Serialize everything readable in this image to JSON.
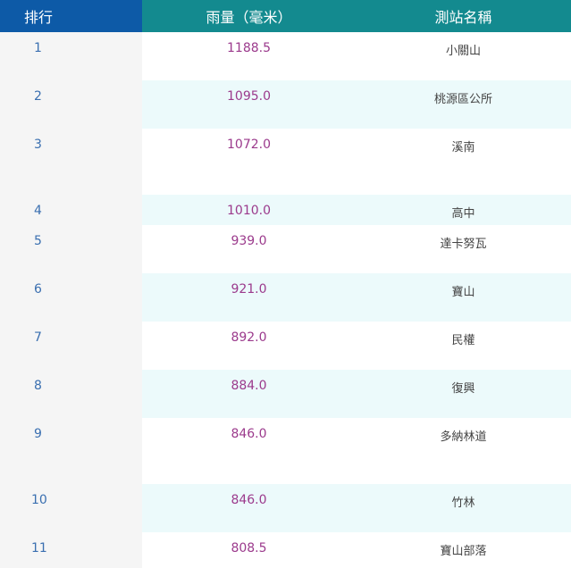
{
  "header": {
    "rank": "排行",
    "rainfall": "雨量（毫米）",
    "station": "測站名稱"
  },
  "rows": [
    {
      "rank": "1",
      "rainfall": "1188.5",
      "station": "小關山"
    },
    {
      "rank": "2",
      "rainfall": "1095.0",
      "station": "桃源區公所"
    },
    {
      "rank": "3",
      "rainfall": "1072.0",
      "station": "溪南"
    },
    {
      "rank": "4",
      "rainfall": "1010.0",
      "station": "高中"
    },
    {
      "rank": "5",
      "rainfall": "939.0",
      "station": "達卡努瓦"
    },
    {
      "rank": "6",
      "rainfall": "921.0",
      "station": "寶山"
    },
    {
      "rank": "7",
      "rainfall": "892.0",
      "station": "民權"
    },
    {
      "rank": "8",
      "rainfall": "884.0",
      "station": "復興"
    },
    {
      "rank": "9",
      "rainfall": "846.0",
      "station": "多納林道"
    },
    {
      "rank": "10",
      "rainfall": "846.0",
      "station": "竹林"
    },
    {
      "rank": "11",
      "rainfall": "808.5",
      "station": "寶山部落"
    }
  ]
}
